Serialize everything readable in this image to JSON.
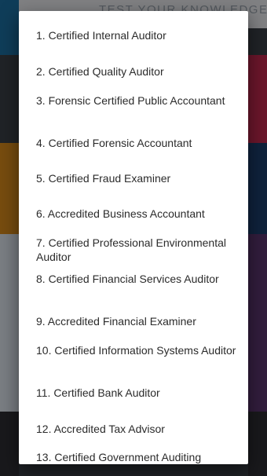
{
  "background": {
    "title": "TEST YOUR KNOWLEDGE"
  },
  "dialog": {
    "items": [
      "1. Certified Internal Auditor",
      "2. Certified Quality Auditor",
      "3. Forensic Certified Public Accountant",
      "4. Certified Forensic Accountant",
      "5. Certified Fraud Examiner",
      "6. Accredited Business Accountant",
      "7. Certified Professional Environmental Auditor",
      "8. Certified Financial Services Auditor",
      "9. Accredited Financial Examiner",
      "10. Certified Information Systems Auditor",
      "11. Certified Bank Auditor",
      "12. Accredited Tax Advisor",
      "13. Certified Government Auditing"
    ]
  }
}
